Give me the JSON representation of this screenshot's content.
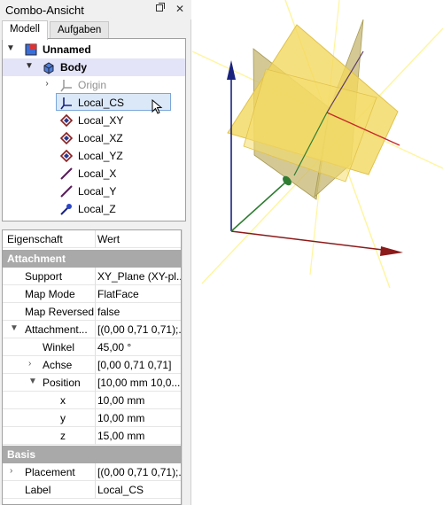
{
  "combo": {
    "title": "Combo-Ansicht",
    "float_icon": "float-icon",
    "close_icon": "close-icon",
    "tabs": [
      {
        "label": "Modell",
        "active": true
      },
      {
        "label": "Aufgaben",
        "active": false
      }
    ]
  },
  "tree": {
    "items": [
      {
        "label": "Unnamed",
        "icon": "document-icon"
      },
      {
        "label": "Body",
        "icon": "body-icon"
      },
      {
        "label": "Origin",
        "icon": "origin-icon"
      },
      {
        "label": "Local_CS",
        "icon": "local-cs-icon"
      },
      {
        "label": "Local_XY",
        "icon": "plane-icon"
      },
      {
        "label": "Local_XZ",
        "icon": "plane-icon"
      },
      {
        "label": "Local_YZ",
        "icon": "plane-icon"
      },
      {
        "label": "Local_X",
        "icon": "axis-icon"
      },
      {
        "label": "Local_Y",
        "icon": "axis-icon"
      },
      {
        "label": "Local_Z",
        "icon": "axis-z-icon"
      }
    ]
  },
  "props": {
    "header": {
      "name": "Eigenschaft",
      "value": "Wert"
    },
    "group_attachment": "Attachment",
    "support": {
      "name": "Support",
      "value": "XY_Plane (XY-pl..."
    },
    "map_mode": {
      "name": "Map Mode",
      "value": "FlatFace"
    },
    "map_reversed": {
      "name": "Map Reversed",
      "value": "false"
    },
    "attachment_offset": {
      "name": "Attachment...",
      "value": "[(0,00 0,71 0,71);..."
    },
    "winkel": {
      "name": "Winkel",
      "value": "45,00 °"
    },
    "achse": {
      "name": "Achse",
      "value": "[0,00 0,71 0,71]"
    },
    "position": {
      "name": "Position",
      "value": "[10,00 mm  10,0..."
    },
    "x": {
      "name": "x",
      "value": "10,00 mm"
    },
    "y": {
      "name": "y",
      "value": "10,00 mm"
    },
    "z": {
      "name": "z",
      "value": "15,00 mm"
    },
    "group_basis": "Basis",
    "placement": {
      "name": "Placement",
      "value": "[(0,00 0,71 0,71);..."
    },
    "label": {
      "name": "Label",
      "value": "Local_CS"
    }
  },
  "colors": {
    "plane_fill": "#f2d75c",
    "plane_line": "#fff176",
    "axis_x": "#8b1a1a",
    "axis_y": "#2e7d32",
    "axis_z": "#1a237e"
  }
}
